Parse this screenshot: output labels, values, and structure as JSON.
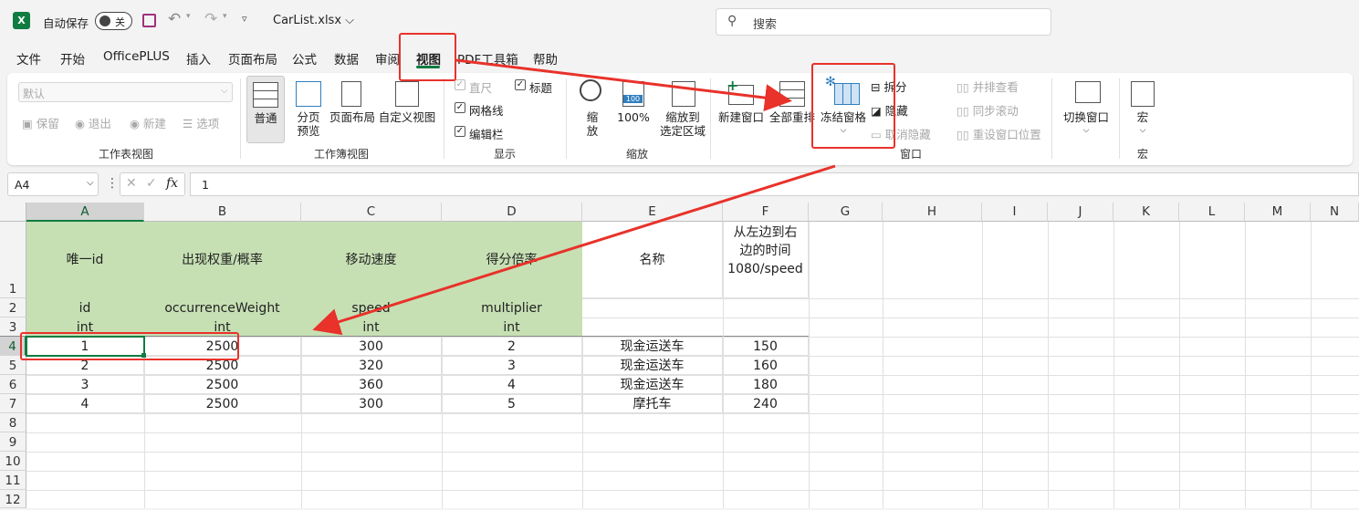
{
  "titlebar": {
    "autosave_label": "自动保存",
    "autosave_state": "关",
    "filename": "CarList.xlsx",
    "search_placeholder": "搜索"
  },
  "menu": [
    "文件",
    "开始",
    "OfficePLUS",
    "插入",
    "页面布局",
    "公式",
    "数据",
    "审阅",
    "视图",
    "PDF工具箱",
    "帮助"
  ],
  "ribbon": {
    "sheet_view": {
      "dropdown_value": "默认",
      "keep": "保留",
      "exit": "退出",
      "new": "新建",
      "options": "选项",
      "label": "工作表视图"
    },
    "workbook_view": {
      "normal": "普通",
      "page_break_1": "分页",
      "page_break_2": "预览",
      "page_layout": "页面布局",
      "custom": "自定义视图",
      "label": "工作簿视图"
    },
    "show": {
      "ruler": "直尺",
      "gridlines": "网格线",
      "formula_bar": "编辑栏",
      "headings": "标题",
      "label": "显示"
    },
    "zoom": {
      "zoom_1": "缩",
      "zoom_2": "放",
      "zoom_100": "100%",
      "zoom_sel_1": "缩放到",
      "zoom_sel_2": "选定区域",
      "label": "缩放",
      "icon_100": "100"
    },
    "window": {
      "new_window": "新建窗口",
      "arrange_all": "全部重排",
      "freeze": "冻结窗格",
      "split": "拆分",
      "hide": "隐藏",
      "unhide": "取消隐藏",
      "side_by_side": "并排查看",
      "sync_scroll": "同步滚动",
      "reset_pos": "重设窗口位置",
      "switch": "切换窗口",
      "label": "窗口"
    },
    "macros": {
      "macros": "宏",
      "label": "宏"
    }
  },
  "formula_bar": {
    "name_box": "A4",
    "formula": "1",
    "fx": "fx"
  },
  "sheet": {
    "columns": [
      "A",
      "B",
      "C",
      "D",
      "E",
      "F",
      "G",
      "H",
      "I",
      "J",
      "K",
      "L",
      "M",
      "N"
    ],
    "rows": [
      "1",
      "2",
      "3",
      "4",
      "5",
      "6",
      "7",
      "8",
      "9",
      "10",
      "11",
      "12"
    ],
    "header_row1": [
      "唯一id",
      "出现权重/概率",
      "移动速度",
      "得分倍率",
      "名称"
    ],
    "header_row1_f": [
      "从左边到右",
      "边的时间",
      "1080/speed"
    ],
    "header_row2": [
      "id",
      "occurrenceWeight",
      "speed",
      "multiplier"
    ],
    "header_row3": [
      "int",
      "int",
      "int",
      "int"
    ],
    "data": [
      [
        "1",
        "2500",
        "300",
        "2",
        "现金运送车",
        "150"
      ],
      [
        "2",
        "2500",
        "320",
        "3",
        "现金运送车",
        "160"
      ],
      [
        "3",
        "2500",
        "360",
        "4",
        "现金运送车",
        "180"
      ],
      [
        "4",
        "2500",
        "300",
        "5",
        "摩托车",
        "240"
      ]
    ]
  },
  "colors": {
    "accent": "#107c41",
    "header_fill": "#c6e0b4",
    "annotation": "#e8322a"
  }
}
